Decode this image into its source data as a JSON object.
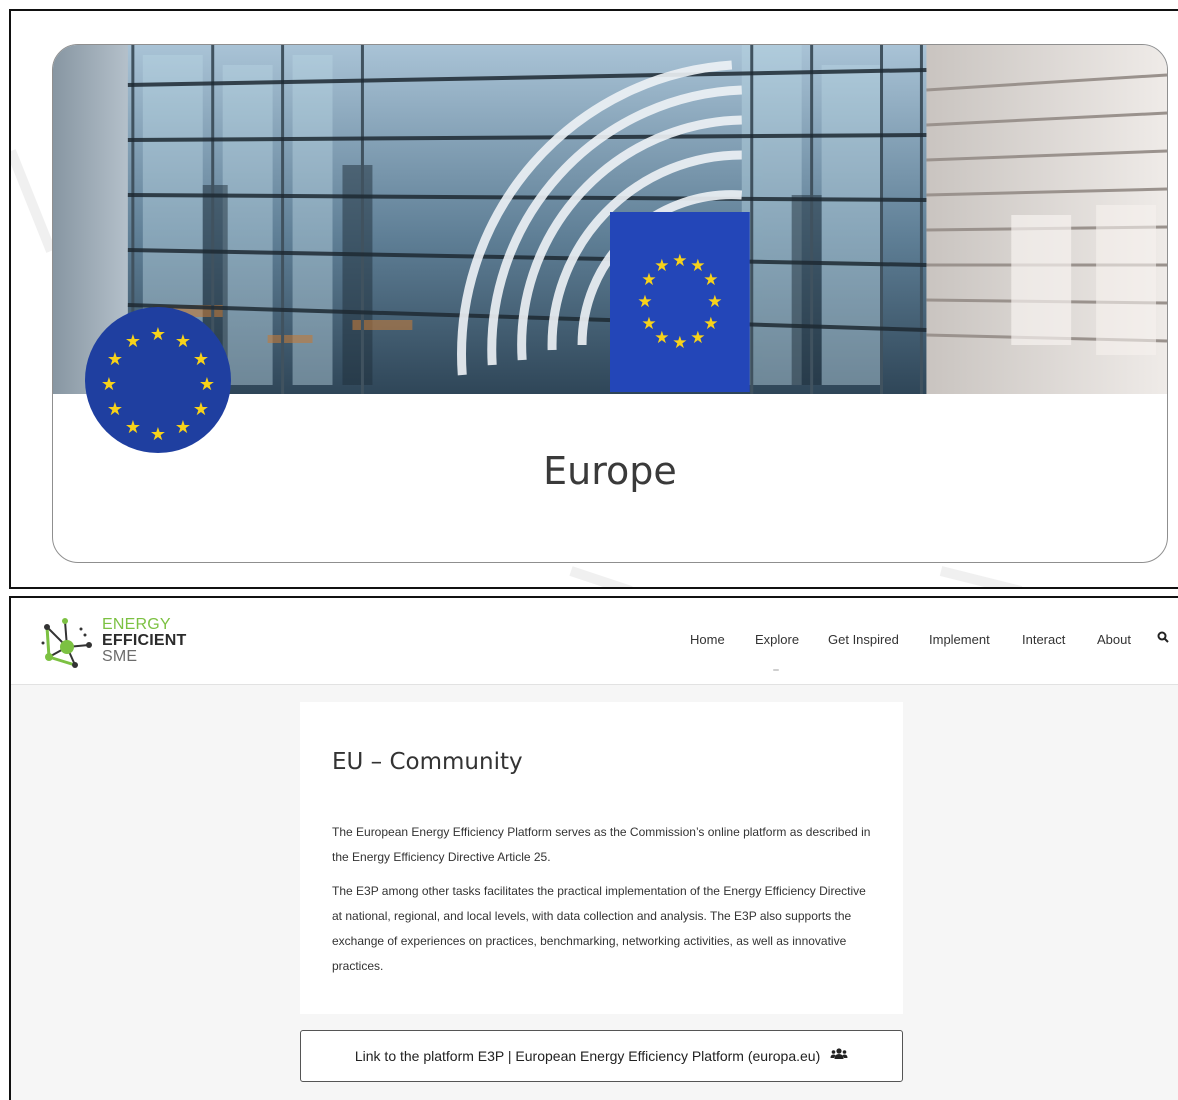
{
  "hero_card": {
    "title": "Europe",
    "hero_image": "european-parliament-building-with-eu-flag",
    "badge": "eu-flag-icon"
  },
  "navbar": {
    "logo": {
      "line1": "ENERGY",
      "line2": "EFFICIENT",
      "line3": "SME"
    },
    "items": [
      {
        "label": "Home"
      },
      {
        "label": "Explore"
      },
      {
        "label": "Get Inspired"
      },
      {
        "label": "Implement"
      },
      {
        "label": "Interact"
      },
      {
        "label": "About"
      }
    ],
    "search_icon": "search-icon"
  },
  "content": {
    "title": "EU – Community",
    "paragraph1": "The European Energy Efficiency Platform serves as the Commission’s online platform as described in the Energy Efficiency Directive Article 25.",
    "paragraph2": "The E3P among other tasks facilitates the practical implementation of the Energy Efficiency Directive at national, regional, and local levels, with data collection and analysis. The E3P also supports the exchange of experiences on practices, benchmarking, networking activities, as well as innovative practices."
  },
  "link_button": {
    "label": "Link to the platform E3P | European Energy Efficiency Platform (europa.eu)",
    "icon": "users-icon"
  },
  "colors": {
    "logo_green": "#7cc142",
    "eu_blue": "#1f3fa0",
    "eu_star": "#f7d21a",
    "page_bg": "#f6f6f6"
  }
}
